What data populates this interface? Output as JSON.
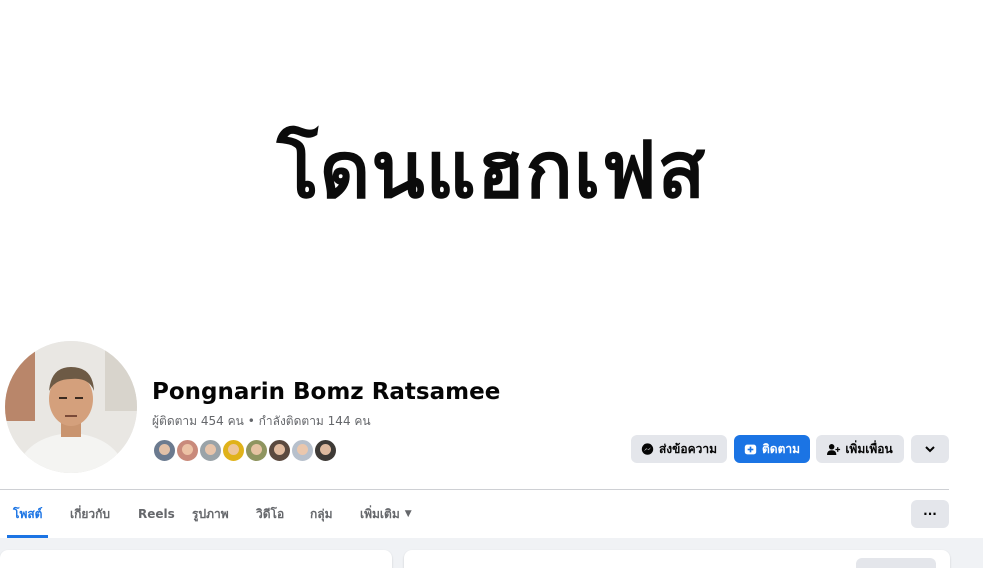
{
  "cover": {
    "text": "โดนแฮกเฟส"
  },
  "profile": {
    "name": "Pongnarin Bomz Ratsamee",
    "followers_label": "ผู้ติดตาม",
    "followers_count": "454",
    "followers_unit": "คน",
    "separator": "•",
    "following_label": "กำลังติดตาม",
    "following_count": "144",
    "following_unit": "คน"
  },
  "friend_avatars": [
    {
      "name": "friend-1",
      "color": "#6b7a8f"
    },
    {
      "name": "friend-2",
      "color": "#c98a7b"
    },
    {
      "name": "friend-3",
      "color": "#9aa3a8"
    },
    {
      "name": "friend-4",
      "color": "#e0b21a"
    },
    {
      "name": "friend-5",
      "color": "#8f9560"
    },
    {
      "name": "friend-6",
      "color": "#5b4a3f"
    },
    {
      "name": "friend-7",
      "color": "#b7c0cc"
    },
    {
      "name": "friend-8",
      "color": "#3e3a36"
    }
  ],
  "actions": {
    "message": "ส่งข้อความ",
    "follow": "ติดตาม",
    "add_friend": "เพิ่มเพื่อน",
    "more_icon": "chevron-down-icon"
  },
  "tabs": [
    {
      "label": "โพสต์",
      "active": true
    },
    {
      "label": "เกี่ยวกับ",
      "active": false
    },
    {
      "label": "Reels",
      "active": false
    },
    {
      "label": "รูปภาพ",
      "active": false
    },
    {
      "label": "วิดีโอ",
      "active": false
    },
    {
      "label": "กลุ่ม",
      "active": false
    },
    {
      "label": "เพิ่มเติม",
      "active": false
    }
  ],
  "tabs_more": "···",
  "colors": {
    "accent": "#1b74e4",
    "button_gray": "#e4e6eb",
    "muted_text": "#65676b",
    "feed_bg": "#f0f2f5"
  }
}
